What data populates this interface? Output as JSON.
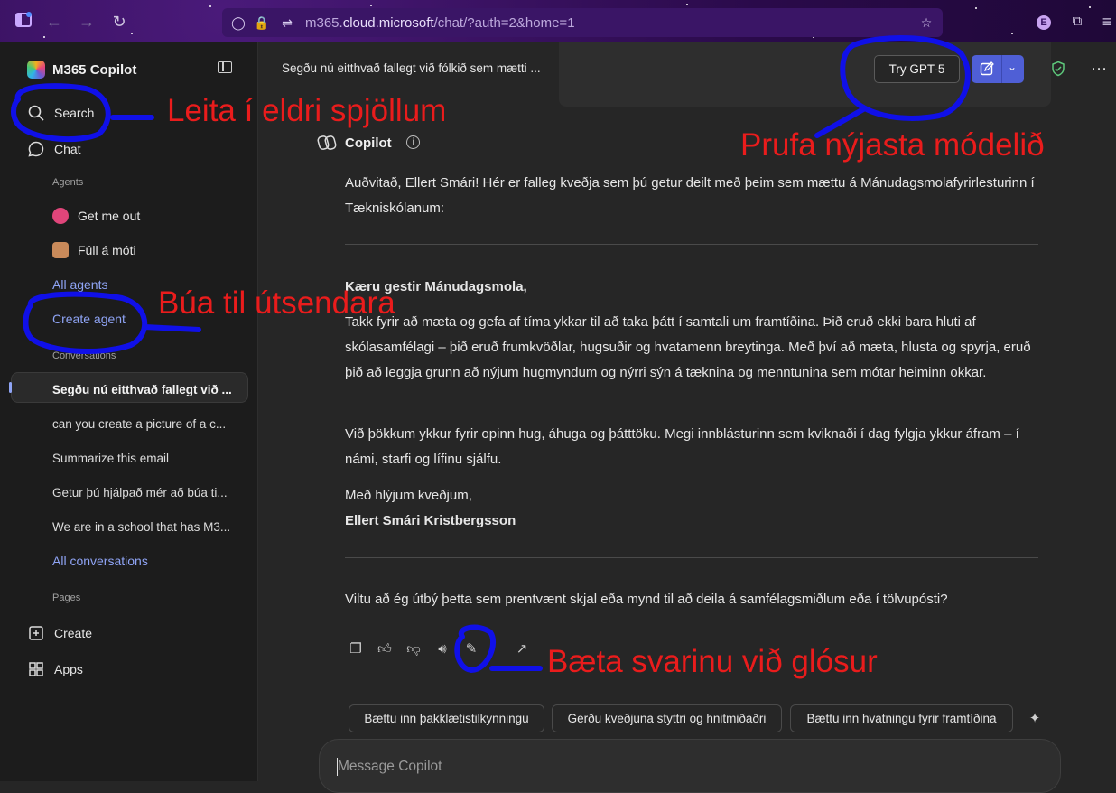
{
  "browser": {
    "url_host": "m365.",
    "url_domain": "cloud.microsoft",
    "url_path": "/chat/?auth=2&home=1",
    "profile_initial": "E"
  },
  "sidebar": {
    "brand": "M365 Copilot",
    "search_label": "Search",
    "chat_label": "Chat",
    "agents_heading": "Agents",
    "agents": [
      {
        "label": "Get me out",
        "color": "#e0457a"
      },
      {
        "label": "Fúll á móti",
        "color": "#c98a5a"
      }
    ],
    "all_agents_label": "All agents",
    "create_agent_label": "Create agent",
    "conversations_heading": "Conversations",
    "conversations": [
      "Segðu nú eitthvað fallegt við ...",
      "can you create a picture of a c...",
      "Summarize this email",
      "Getur þú hjálpað mér að búa ti...",
      "We are in a school that has M3..."
    ],
    "all_conversations_label": "All conversations",
    "pages_heading": "Pages",
    "create_label": "Create",
    "apps_label": "Apps"
  },
  "topbar": {
    "title": "Segðu nú eitthvað fallegt við fólkið sem mætti ...",
    "try_button": "Try GPT-5"
  },
  "message": {
    "sender": "Copilot",
    "intro": "Auðvitað, Ellert Smári! Hér er falleg kveðja sem þú getur deilt með þeim sem mættu á Mánudagsmolafyrirlesturinn í Tækniskólanum:",
    "greeting": "Kæru gestir Mánudagsmola,",
    "body1": "Takk fyrir að mæta og gefa af tíma ykkar til að taka þátt í samtali um framtíðina. Þið eruð ekki bara hluti af skólasamfélagi – þið eruð frumkvöðlar, hugsuðir og hvatamenn breytinga. Með því að mæta, hlusta og spyrja, eruð þið að leggja grunn að nýjum hugmyndum og nýrri sýn á tæknina og menntunina sem mótar heiminn okkar.",
    "body2": "Við þökkum ykkur fyrir opinn hug, áhuga og þátttöku. Megi innblásturinn sem kviknaði í dag fylgja ykkur áfram – í námi, starfi og lífinu sjálfu.",
    "signoff": "Með hlýjum kveðjum,",
    "signature": "Ellert Smári Kristbergsson",
    "followup": "Viltu að ég útbý þetta sem prentvænt skjal eða mynd til að deila á samfélagsmiðlum eða í tölvupósti?"
  },
  "suggestions": [
    "Bættu inn þakklætistilkynningu",
    "Gerðu kveðjuna styttri og hnitmiðaðri",
    "Bættu inn hvatningu fyrir framtíðina"
  ],
  "composer": {
    "placeholder": "Message Copilot"
  },
  "annotations": {
    "search": "Leita í eldri spjöllum",
    "create_agent": "Búa til útsendara",
    "try_model": "Prufa nýjasta módelið",
    "notes": "Bæta svarinu við glósur",
    "text_color": "#ea1c1c",
    "marker_color": "#1010e8"
  },
  "colors": {
    "accent": "#4f5fd6",
    "link": "#8fa4f5"
  }
}
